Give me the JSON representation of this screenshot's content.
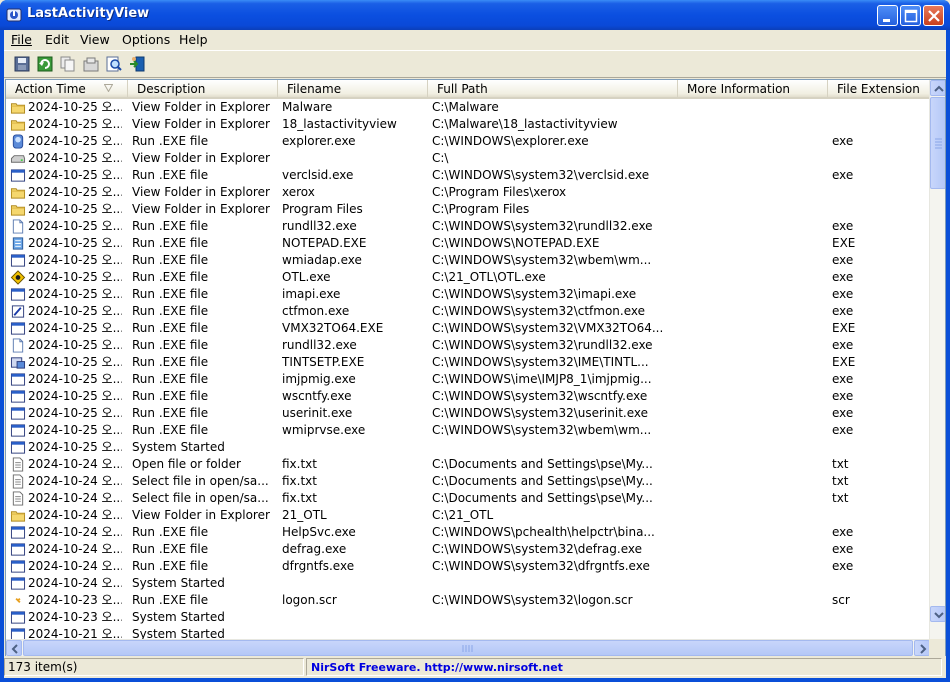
{
  "window": {
    "title": "LastActivityView"
  },
  "menu": [
    {
      "label": "File"
    },
    {
      "label": "Edit"
    },
    {
      "label": "View"
    },
    {
      "label": "Options"
    },
    {
      "label": "Help"
    }
  ],
  "toolbar": {
    "buttons": [
      {
        "icon": "save-icon"
      },
      {
        "icon": "refresh-icon"
      },
      {
        "icon": "copy-icon"
      },
      {
        "icon": "properties-icon"
      },
      {
        "icon": "find-icon"
      },
      {
        "icon": "exit-icon"
      }
    ]
  },
  "columns": [
    "Action Time",
    "Description",
    "Filename",
    "Full Path",
    "More Information",
    "File Extension"
  ],
  "rows": [
    {
      "icon": "folder",
      "time": "2024-10-25 오...",
      "desc": "View Folder in Explorer",
      "file": "Malware",
      "path": "C:\\Malware",
      "info": "",
      "ext": ""
    },
    {
      "icon": "folder",
      "time": "2024-10-25 오...",
      "desc": "View Folder in Explorer",
      "file": "18_lastactivityview",
      "path": "C:\\Malware\\18_lastactivityview",
      "info": "",
      "ext": ""
    },
    {
      "icon": "explorer",
      "time": "2024-10-25 오...",
      "desc": "Run .EXE file",
      "file": "explorer.exe",
      "path": "C:\\WINDOWS\\explorer.exe",
      "info": "",
      "ext": "exe"
    },
    {
      "icon": "drive",
      "time": "2024-10-25 오...",
      "desc": "View Folder in Explorer",
      "file": "",
      "path": "C:\\",
      "info": "",
      "ext": ""
    },
    {
      "icon": "window",
      "time": "2024-10-25 오...",
      "desc": "Run .EXE file",
      "file": "verclsid.exe",
      "path": "C:\\WINDOWS\\system32\\verclsid.exe",
      "info": "",
      "ext": "exe"
    },
    {
      "icon": "folder",
      "time": "2024-10-25 오...",
      "desc": "View Folder in Explorer",
      "file": "xerox",
      "path": "C:\\Program Files\\xerox",
      "info": "",
      "ext": ""
    },
    {
      "icon": "folder",
      "time": "2024-10-25 오...",
      "desc": "View Folder in Explorer",
      "file": "Program Files",
      "path": "C:\\Program Files",
      "info": "",
      "ext": ""
    },
    {
      "icon": "page",
      "time": "2024-10-25 오...",
      "desc": "Run .EXE file",
      "file": "rundll32.exe",
      "path": "C:\\WINDOWS\\system32\\rundll32.exe",
      "info": "",
      "ext": "exe"
    },
    {
      "icon": "notepad",
      "time": "2024-10-25 오...",
      "desc": "Run .EXE file",
      "file": "NOTEPAD.EXE",
      "path": "C:\\WINDOWS\\NOTEPAD.EXE",
      "info": "",
      "ext": "EXE"
    },
    {
      "icon": "window",
      "time": "2024-10-25 오...",
      "desc": "Run .EXE file",
      "file": "wmiadap.exe",
      "path": "C:\\WINDOWS\\system32\\wbem\\wm...",
      "info": "",
      "ext": "exe"
    },
    {
      "icon": "otl",
      "time": "2024-10-25 오...",
      "desc": "Run .EXE file",
      "file": "OTL.exe",
      "path": "C:\\21_OTL\\OTL.exe",
      "info": "",
      "ext": "exe"
    },
    {
      "icon": "window",
      "time": "2024-10-25 오...",
      "desc": "Run .EXE file",
      "file": "imapi.exe",
      "path": "C:\\WINDOWS\\system32\\imapi.exe",
      "info": "",
      "ext": "exe"
    },
    {
      "icon": "pen",
      "time": "2024-10-25 오...",
      "desc": "Run .EXE file",
      "file": "ctfmon.exe",
      "path": "C:\\WINDOWS\\system32\\ctfmon.exe",
      "info": "",
      "ext": "exe"
    },
    {
      "icon": "window",
      "time": "2024-10-25 오...",
      "desc": "Run .EXE file",
      "file": "VMX32TO64.EXE",
      "path": "C:\\WINDOWS\\system32\\VMX32TO64...",
      "info": "",
      "ext": "EXE"
    },
    {
      "icon": "page",
      "time": "2024-10-25 오...",
      "desc": "Run .EXE file",
      "file": "rundll32.exe",
      "path": "C:\\WINDOWS\\system32\\rundll32.exe",
      "info": "",
      "ext": "exe"
    },
    {
      "icon": "setup",
      "time": "2024-10-25 오...",
      "desc": "Run .EXE file",
      "file": "TINTSETP.EXE",
      "path": "C:\\WINDOWS\\system32\\IME\\TINTL...",
      "info": "",
      "ext": "EXE"
    },
    {
      "icon": "window",
      "time": "2024-10-25 오...",
      "desc": "Run .EXE file",
      "file": "imjpmig.exe",
      "path": "C:\\WINDOWS\\ime\\IMJP8_1\\imjpmig...",
      "info": "",
      "ext": "exe"
    },
    {
      "icon": "window",
      "time": "2024-10-25 오...",
      "desc": "Run .EXE file",
      "file": "wscntfy.exe",
      "path": "C:\\WINDOWS\\system32\\wscntfy.exe",
      "info": "",
      "ext": "exe"
    },
    {
      "icon": "window",
      "time": "2024-10-25 오...",
      "desc": "Run .EXE file",
      "file": "userinit.exe",
      "path": "C:\\WINDOWS\\system32\\userinit.exe",
      "info": "",
      "ext": "exe"
    },
    {
      "icon": "window",
      "time": "2024-10-25 오...",
      "desc": "Run .EXE file",
      "file": "wmiprvse.exe",
      "path": "C:\\WINDOWS\\system32\\wbem\\wm...",
      "info": "",
      "ext": "exe"
    },
    {
      "icon": "window",
      "time": "2024-10-25 오...",
      "desc": "System Started",
      "file": "",
      "path": "",
      "info": "",
      "ext": ""
    },
    {
      "icon": "text",
      "time": "2024-10-24 오...",
      "desc": "Open file or folder",
      "file": "fix.txt",
      "path": "C:\\Documents and Settings\\pse\\My...",
      "info": "",
      "ext": "txt"
    },
    {
      "icon": "text",
      "time": "2024-10-24 오...",
      "desc": "Select file in open/sa...",
      "file": "fix.txt",
      "path": "C:\\Documents and Settings\\pse\\My...",
      "info": "",
      "ext": "txt"
    },
    {
      "icon": "text",
      "time": "2024-10-24 오...",
      "desc": "Select file in open/sa...",
      "file": "fix.txt",
      "path": "C:\\Documents and Settings\\pse\\My...",
      "info": "",
      "ext": "txt"
    },
    {
      "icon": "folder",
      "time": "2024-10-24 오...",
      "desc": "View Folder in Explorer",
      "file": "21_OTL",
      "path": "C:\\21_OTL",
      "info": "",
      "ext": ""
    },
    {
      "icon": "window",
      "time": "2024-10-24 오...",
      "desc": "Run .EXE file",
      "file": "HelpSvc.exe",
      "path": "C:\\WINDOWS\\pchealth\\helpctr\\bina...",
      "info": "",
      "ext": "exe"
    },
    {
      "icon": "window",
      "time": "2024-10-24 오...",
      "desc": "Run .EXE file",
      "file": "defrag.exe",
      "path": "C:\\WINDOWS\\system32\\defrag.exe",
      "info": "",
      "ext": "exe"
    },
    {
      "icon": "window",
      "time": "2024-10-24 오...",
      "desc": "Run .EXE file",
      "file": "dfrgntfs.exe",
      "path": "C:\\WINDOWS\\system32\\dfrgntfs.exe",
      "info": "",
      "ext": "exe"
    },
    {
      "icon": "window",
      "time": "2024-10-24 오...",
      "desc": "System Started",
      "file": "",
      "path": "",
      "info": "",
      "ext": ""
    },
    {
      "icon": "logon",
      "time": "2024-10-23 오...",
      "desc": "Run .EXE file",
      "file": "logon.scr",
      "path": "C:\\WINDOWS\\system32\\logon.scr",
      "info": "",
      "ext": "scr"
    },
    {
      "icon": "window",
      "time": "2024-10-23 오...",
      "desc": "System Started",
      "file": "",
      "path": "",
      "info": "",
      "ext": ""
    },
    {
      "icon": "window",
      "time": "2024-10-21 오...",
      "desc": "System Started",
      "file": "",
      "path": "",
      "info": "",
      "ext": ""
    }
  ],
  "status": {
    "count": "173 item(s)",
    "credit": "NirSoft Freeware.  http://www.nirsoft.net"
  }
}
